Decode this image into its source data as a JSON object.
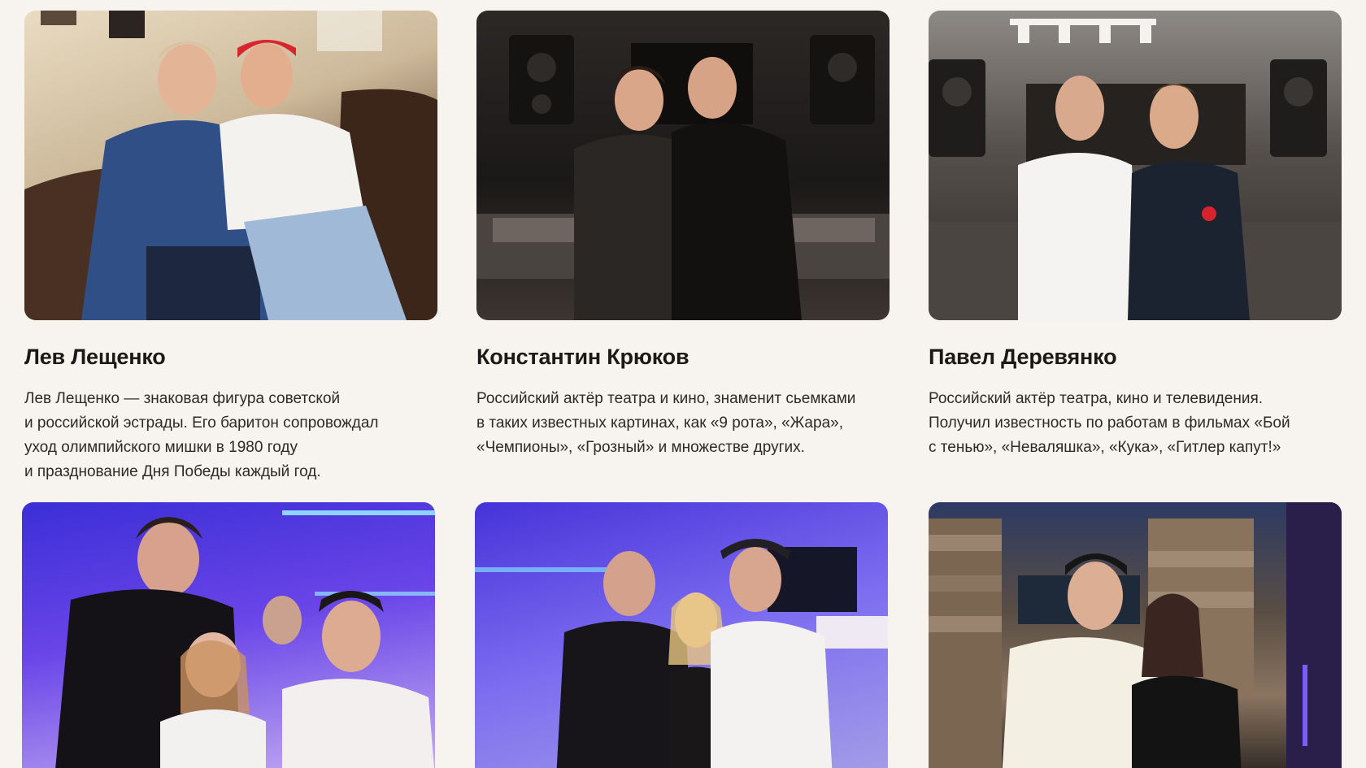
{
  "cards": [
    {
      "name": "Лев Лещенко",
      "description": "Лев Лещенко — знаковая фигура советской\nи российской эстрады. Его баритон сопровождал\nуход олимпийского мишки в 1980 году\nи празднование Дня Победы каждый год."
    },
    {
      "name": "Константин Крюков",
      "description": "Российский актёр театра и кино, знаменит сьемками\nв таких известных картинах, как «9 рота», «Жара»,\n«Чемпионы», «Грозный» и множестве других."
    },
    {
      "name": "Павел Деревянко",
      "description": "Российский актёр театра, кино и телевидения.\nПолучил известность по работам в фильмах «Бой\nс тенью», «Неваляшка», «Кука», «Гитлер капут!»"
    },
    {
      "name": "",
      "description": ""
    },
    {
      "name": "",
      "description": ""
    },
    {
      "name": "",
      "description": ""
    }
  ]
}
